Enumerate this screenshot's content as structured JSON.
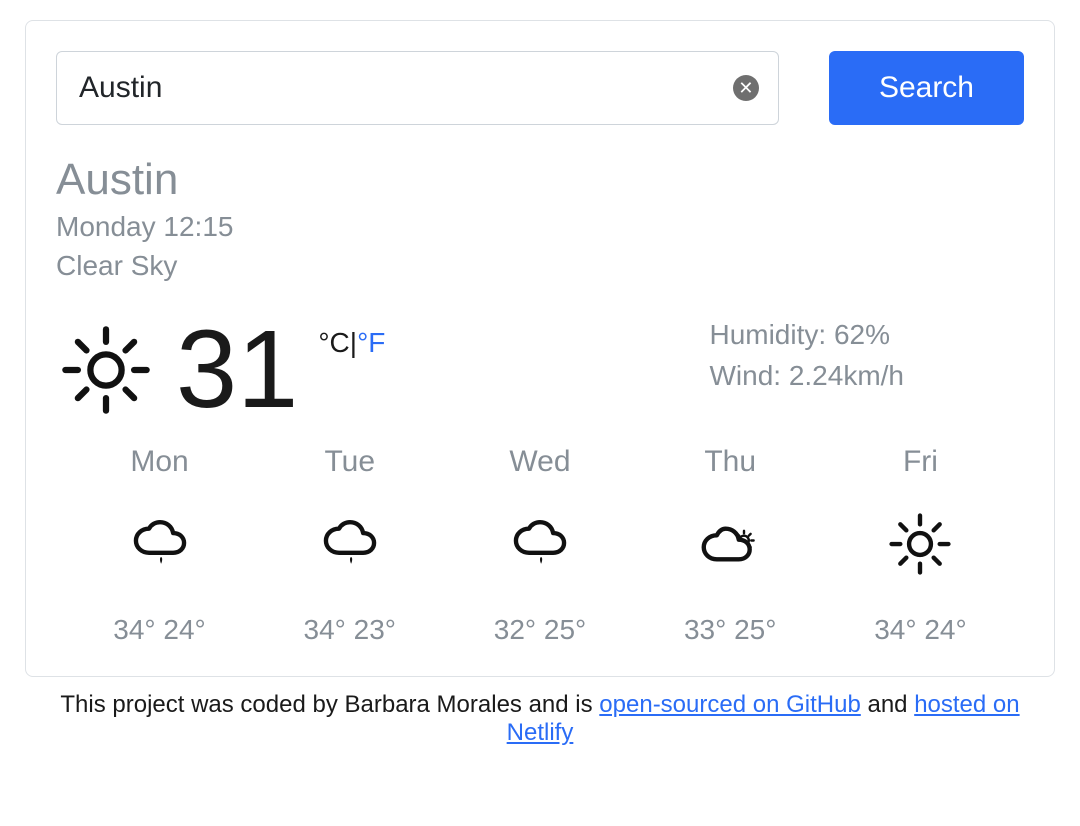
{
  "search": {
    "value": "Austin",
    "placeholder": "",
    "button_label": "Search"
  },
  "current": {
    "city": "Austin",
    "datetime": "Monday 12:15",
    "condition": "Clear Sky",
    "temp": "31",
    "unit_c": "°C",
    "unit_sep": "|",
    "unit_f": "°F",
    "humidity_label": "Humidity: 62%",
    "wind_label": "Wind: 2.24km/h",
    "icon": "sun-icon"
  },
  "forecast": [
    {
      "day": "Mon",
      "icon": "rain-icon",
      "high": "34°",
      "low": "24°"
    },
    {
      "day": "Tue",
      "icon": "rain-icon",
      "high": "34°",
      "low": "23°"
    },
    {
      "day": "Wed",
      "icon": "rain-icon",
      "high": "32°",
      "low": "25°"
    },
    {
      "day": "Thu",
      "icon": "partly-cloudy-icon",
      "high": "33°",
      "low": "25°"
    },
    {
      "day": "Fri",
      "icon": "sun-icon",
      "high": "34°",
      "low": "24°"
    }
  ],
  "footer": {
    "prefix": "This project was coded by Barbara Morales and is ",
    "link1": "open-sourced on GitHub",
    "mid": " and ",
    "link2": "hosted on Netlify"
  }
}
